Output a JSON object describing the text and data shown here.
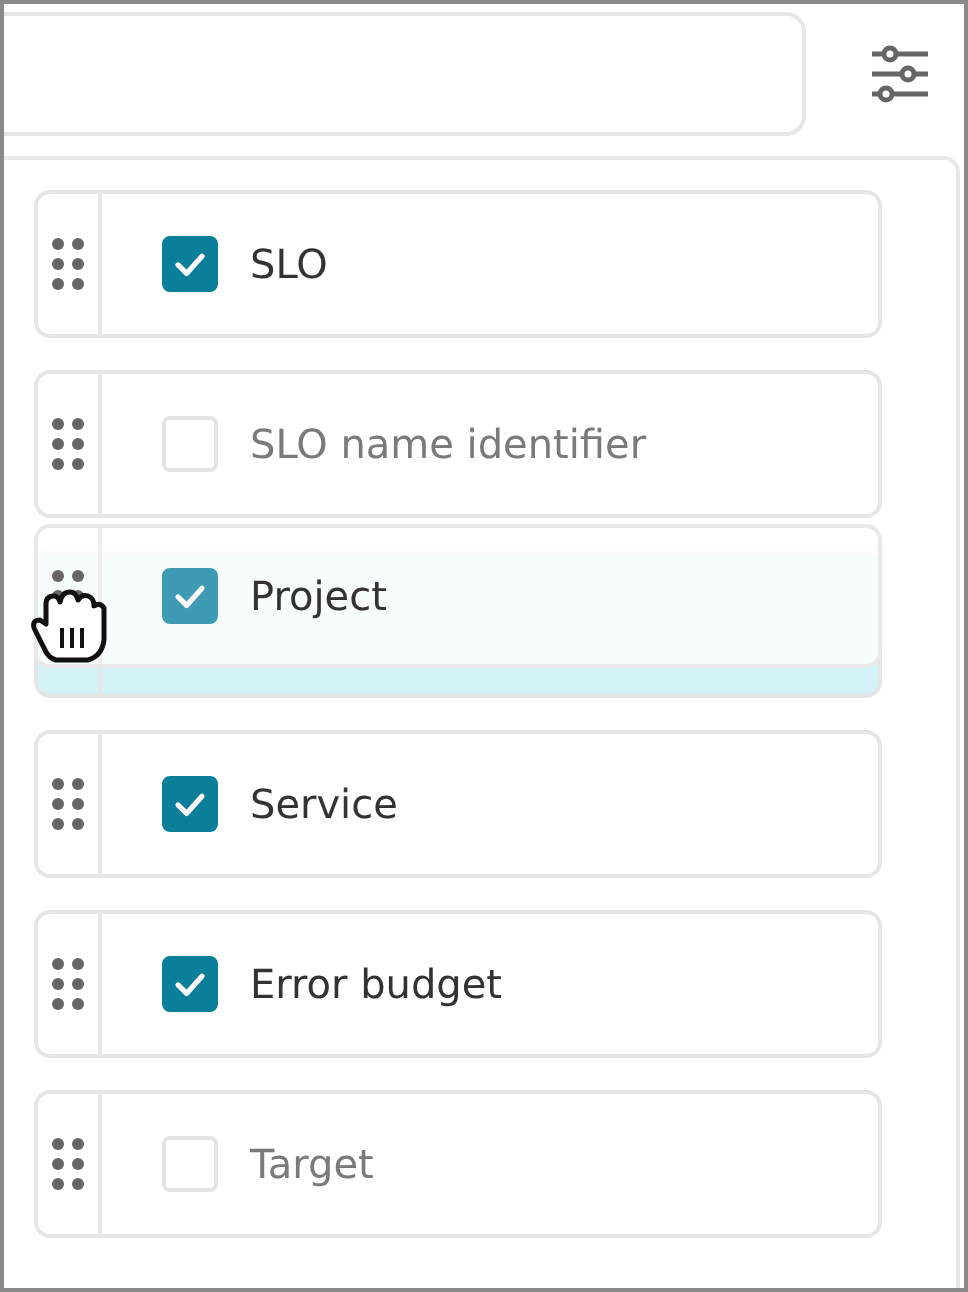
{
  "columns": [
    {
      "kind": "column",
      "label": "SLO",
      "checked": true
    },
    {
      "kind": "column",
      "label": "SLO name identifier",
      "checked": false
    },
    {
      "kind": "drop-slot"
    },
    {
      "kind": "column",
      "label": "Service",
      "checked": true
    },
    {
      "kind": "column",
      "label": "Error budget",
      "checked": true
    },
    {
      "kind": "column",
      "label": "Target",
      "checked": false
    }
  ],
  "drag_ghost": {
    "label": "Project",
    "checked": true
  }
}
